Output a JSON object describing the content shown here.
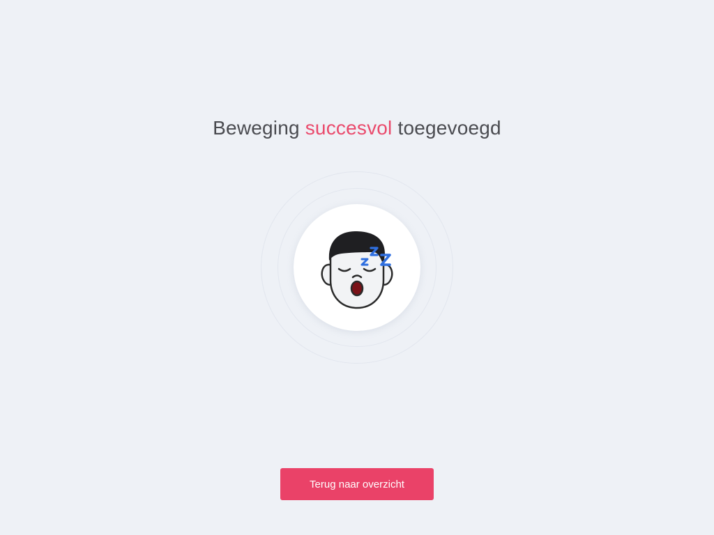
{
  "header": {
    "title_prefix": "Beweging ",
    "title_accent": "succesvol",
    "title_suffix": " toegevoegd",
    "accent_color": "#ea4a6c"
  },
  "illustration": {
    "icon": "sleeping-face-icon",
    "zzz_color": "#2f6fe0"
  },
  "actions": {
    "back_label": "Terug naar overzicht",
    "button_color": "#ea4268"
  }
}
